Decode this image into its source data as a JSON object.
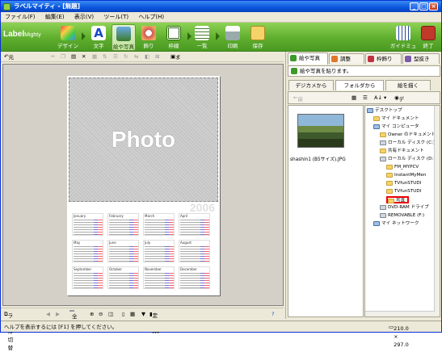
{
  "window": {
    "title": "ラベルマイティ - [無題]"
  },
  "menu": [
    "ファイル(F)",
    "編集(E)",
    "表示(V)",
    "ツール(T)",
    "ヘルプ(H)"
  ],
  "logo": {
    "main": "Label",
    "sub": "Mighty"
  },
  "toolbar": {
    "design": "デザイン",
    "text": "文字",
    "image": "絵や写真",
    "decoration": "飾り",
    "frame": "枠線",
    "list": "一覧",
    "print": "印刷",
    "save": "保存",
    "guide": "ガイドミュー",
    "exit": "終了"
  },
  "subbar": {
    "undo": "元に戻す",
    "batch_input": "まとめて入力"
  },
  "canvas": {
    "photo_label": "Photo",
    "year": "2006",
    "months": [
      "January",
      "February",
      "March",
      "April",
      "May",
      "June",
      "July",
      "August",
      "September",
      "October",
      "November",
      "December"
    ]
  },
  "bottombar": {
    "label_switch": "ラベル切替",
    "zoom": "全面",
    "paper": "定型 A4"
  },
  "right_panel": {
    "tabs": [
      "絵や写真",
      "調整",
      "枠飾り",
      "型抜き"
    ],
    "hint": "絵や写真を貼ります。",
    "subtabs": [
      "デジカメから",
      "フォルダから",
      "絵を描く"
    ],
    "back_button": "戻る",
    "camera_button": "デジカメ",
    "thumbnail_name": "shashin1 (B5サイズ).JPG",
    "tree": [
      {
        "label": "デスクトップ",
        "indent": 0,
        "type": "pc"
      },
      {
        "label": "マイ ドキュメント",
        "indent": 1,
        "type": "folder"
      },
      {
        "label": "マイ コンピュータ",
        "indent": 1,
        "type": "pc"
      },
      {
        "label": "Owner のドキュメント",
        "indent": 2,
        "type": "folder"
      },
      {
        "label": "ローカル ディスク (C:)",
        "indent": 2,
        "type": "drive"
      },
      {
        "label": "共有ドキュメント",
        "indent": 2,
        "type": "folder"
      },
      {
        "label": "ローカル ディスク (D:)",
        "indent": 2,
        "type": "drive"
      },
      {
        "label": "FM_MYPCV",
        "indent": 3,
        "type": "folder"
      },
      {
        "label": "InstantMyMen",
        "indent": 3,
        "type": "folder"
      },
      {
        "label": "TVfunSTUDI",
        "indent": 3,
        "type": "folder"
      },
      {
        "label": "TVfunSTUDI",
        "indent": 3,
        "type": "folder"
      },
      {
        "label": "写真",
        "indent": 3,
        "type": "folder",
        "selected": true
      },
      {
        "label": "DVD-RAM ドライブ",
        "indent": 2,
        "type": "drive"
      },
      {
        "label": "REMOVABLE (F:)",
        "indent": 2,
        "type": "drive"
      },
      {
        "label": "マイ ネットワーク",
        "indent": 1,
        "type": "pc"
      }
    ]
  },
  "statusbar": {
    "help": "ヘルプを表示するには [F1] を押してください。",
    "size": "210.0 × 297.0"
  }
}
